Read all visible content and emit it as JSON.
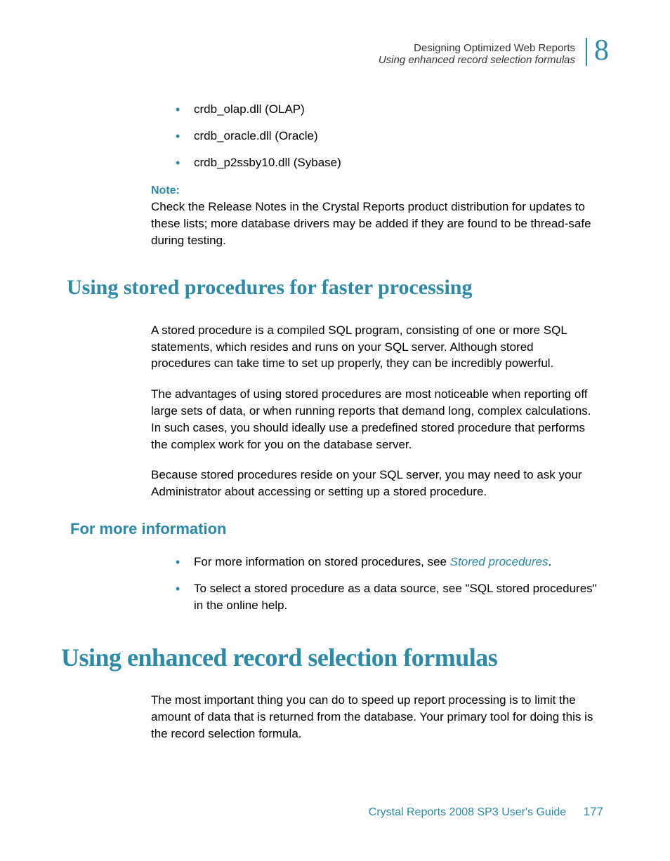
{
  "header": {
    "line1": "Designing Optimized Web Reports",
    "line2": "Using enhanced record selection formulas",
    "chapter_number": "8"
  },
  "top_bullets": [
    "crdb_olap.dll (OLAP)",
    "crdb_oracle.dll (Oracle)",
    "crdb_p2ssby10.dll (Sybase)"
  ],
  "note": {
    "label": "Note:",
    "text": "Check the Release Notes in the Crystal Reports product distribution for updates to these lists; more database drivers may be added if they are found to be thread-safe during testing."
  },
  "section1": {
    "heading": "Using stored procedures for faster processing",
    "para1": "A stored procedure is a compiled SQL program, consisting of one or more SQL statements, which resides and runs on your SQL server. Although stored procedures can take time to set up properly, they can be incredibly powerful.",
    "para2": "The advantages of using stored procedures are most noticeable when reporting off large sets of data, or when running reports that demand long, complex calculations. In such cases, you should ideally use a predefined stored procedure that performs the complex work for you on the database server.",
    "para3": "Because stored procedures reside on your SQL server, you may need to ask your Administrator about accessing or setting up a stored procedure."
  },
  "section2": {
    "heading": "For more information",
    "bullet1_prefix": "For more information on stored procedures, see ",
    "bullet1_link": "Stored procedures",
    "bullet1_suffix": ".",
    "bullet2": "To select a stored procedure as a data source, see \"SQL stored procedures\" in the online help."
  },
  "section3": {
    "heading": "Using enhanced record selection formulas",
    "para1": "The most important thing you can do to speed up report processing is to limit the amount of data that is returned from the database. Your primary tool for doing this is the record selection formula."
  },
  "footer": {
    "text": "Crystal Reports 2008 SP3 User's Guide",
    "page": "177"
  }
}
